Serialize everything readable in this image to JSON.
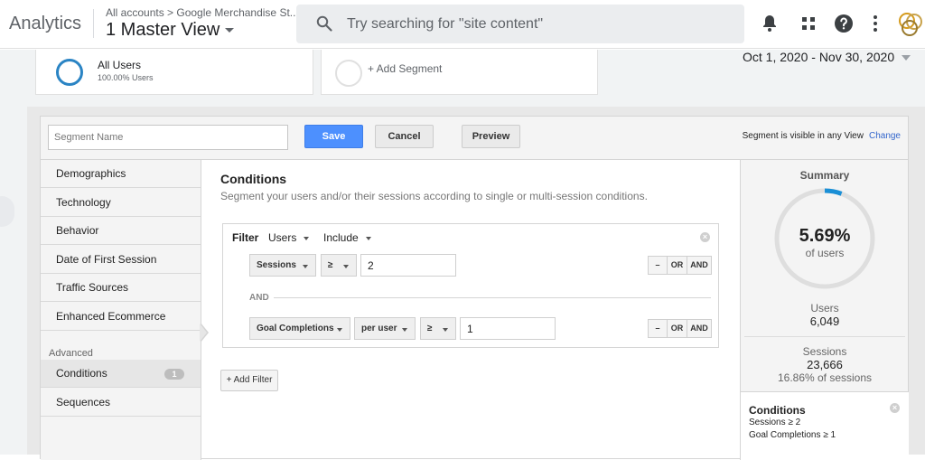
{
  "app": {
    "brand": "Analytics",
    "breadcrumb": "All accounts > Google Merchandise St...",
    "view_name": "1 Master View"
  },
  "search": {
    "placeholder": "Try searching for \"site content\""
  },
  "segments": {
    "active": {
      "name": "All Users",
      "percent": "100.00% Users"
    },
    "add_label": "+ Add Segment"
  },
  "date_range": "Oct 1, 2020 - Nov 30, 2020",
  "editor": {
    "segment_name_placeholder": "Segment Name",
    "save_label": "Save",
    "cancel_label": "Cancel",
    "preview_label": "Preview",
    "visibility_text": "Segment is visible in any View",
    "change_label": "Change"
  },
  "nav": {
    "items": [
      "Demographics",
      "Technology",
      "Behavior",
      "Date of First Session",
      "Traffic Sources",
      "Enhanced Ecommerce"
    ],
    "advanced_heading": "Advanced",
    "conditions_label": "Conditions",
    "conditions_count": "1",
    "sequences_label": "Sequences"
  },
  "conditions": {
    "title": "Conditions",
    "subtitle": "Segment your users and/or their sessions according to single or multi-session conditions.",
    "filter_label": "Filter",
    "scope": "Users",
    "mode": "Include",
    "and_label": "AND",
    "rows": [
      {
        "metric": "Sessions",
        "operator": "≥",
        "value": "2"
      },
      {
        "metric": "Goal Completions",
        "per": "per user",
        "operator": "≥",
        "value": "1"
      }
    ],
    "minus_label": "–",
    "or_label": "OR",
    "and_btn_label": "AND",
    "add_filter_label": "+ Add Filter"
  },
  "summary": {
    "title": "Summary",
    "percent": "5.69%",
    "percent_value": 5.69,
    "of_label": "of users",
    "users_label": "Users",
    "users_value": "6,049",
    "sessions_label": "Sessions",
    "sessions_value": "23,666",
    "sessions_pct": "16.86% of sessions",
    "card_title": "Conditions",
    "card_lines": [
      "Sessions ≥ 2",
      "Goal Completions ≥ 1"
    ]
  },
  "colors": {
    "accent": "#4d90fe",
    "gauge": "#1a8fd6",
    "segment_ring": "#2a84c4"
  }
}
